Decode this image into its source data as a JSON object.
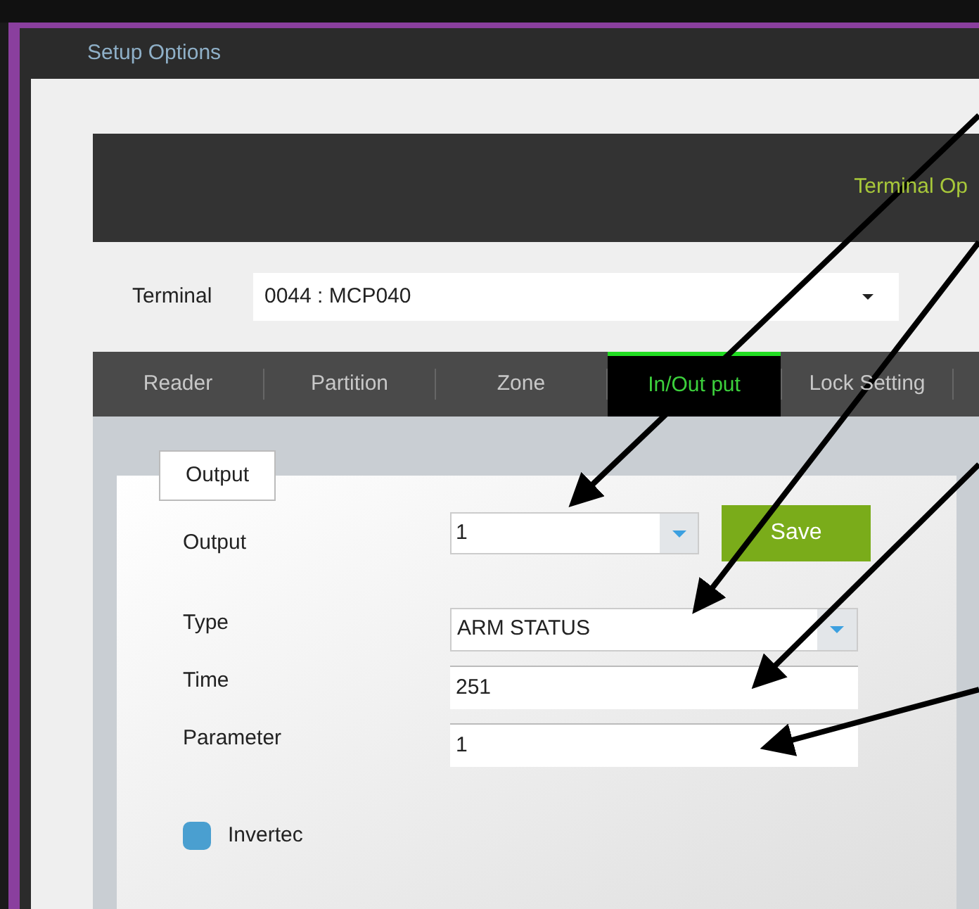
{
  "window": {
    "title": "Setup Options"
  },
  "banner": {
    "title": "Terminal Op"
  },
  "terminal": {
    "label": "Terminal",
    "value": "0044 : MCP040"
  },
  "tabs": [
    {
      "label": "Reader",
      "selected": false
    },
    {
      "label": "Partition",
      "selected": false
    },
    {
      "label": "Zone",
      "selected": false
    },
    {
      "label": "In/Out put",
      "selected": true
    },
    {
      "label": "Lock Setting",
      "selected": false
    }
  ],
  "group": {
    "title": "Output"
  },
  "output": {
    "label": "Output",
    "value": "1"
  },
  "save_button": "Save",
  "fields": [
    {
      "kind": "select",
      "label": "Type",
      "value": "ARM STATUS"
    },
    {
      "kind": "text",
      "label": "Time",
      "value": "251"
    },
    {
      "kind": "text",
      "label": "Parameter",
      "value": "1"
    }
  ],
  "inverted": {
    "label": "Invertec",
    "checked": true
  }
}
